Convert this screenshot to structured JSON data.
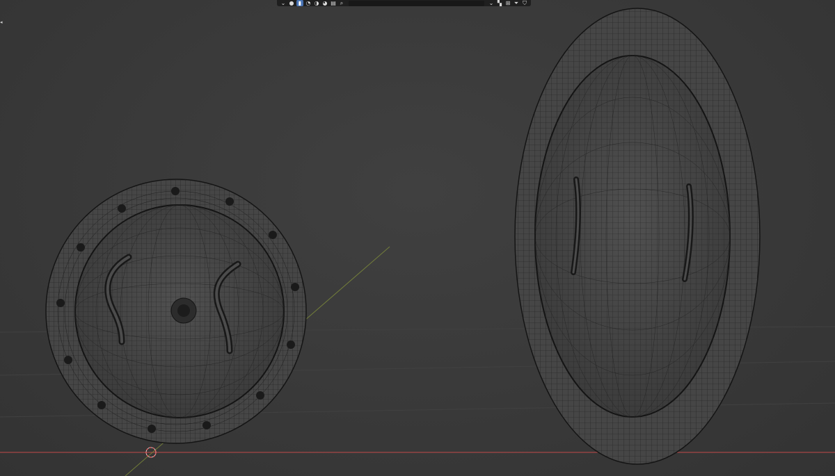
{
  "viewport": {
    "background": "#3a3a3a",
    "x_axis_color": "#c24a4a",
    "y_axis_color": "#8a9a3a",
    "wireframe_color": "#1e1e1e",
    "mesh_fill": "#4a4a4a"
  },
  "header_toolbar": {
    "icons": [
      "dropdown-chevron-icon",
      "overlay-sphere-icon",
      "solid-shading-icon",
      "wireframe-shading-icon",
      "material-shading-icon",
      "rendered-shading-icon",
      "filter-icon",
      "search-icon",
      "dropdown-chevron-icon",
      "bookmark-icon",
      "layout-icon",
      "funnel-icon",
      "shield-icon"
    ]
  },
  "objects": [
    {
      "name": "round-hatch",
      "type": "wireframe-mesh"
    },
    {
      "name": "oval-hatch",
      "type": "wireframe-mesh"
    }
  ],
  "cursor_3d": {
    "name": "3d-cursor-icon"
  }
}
